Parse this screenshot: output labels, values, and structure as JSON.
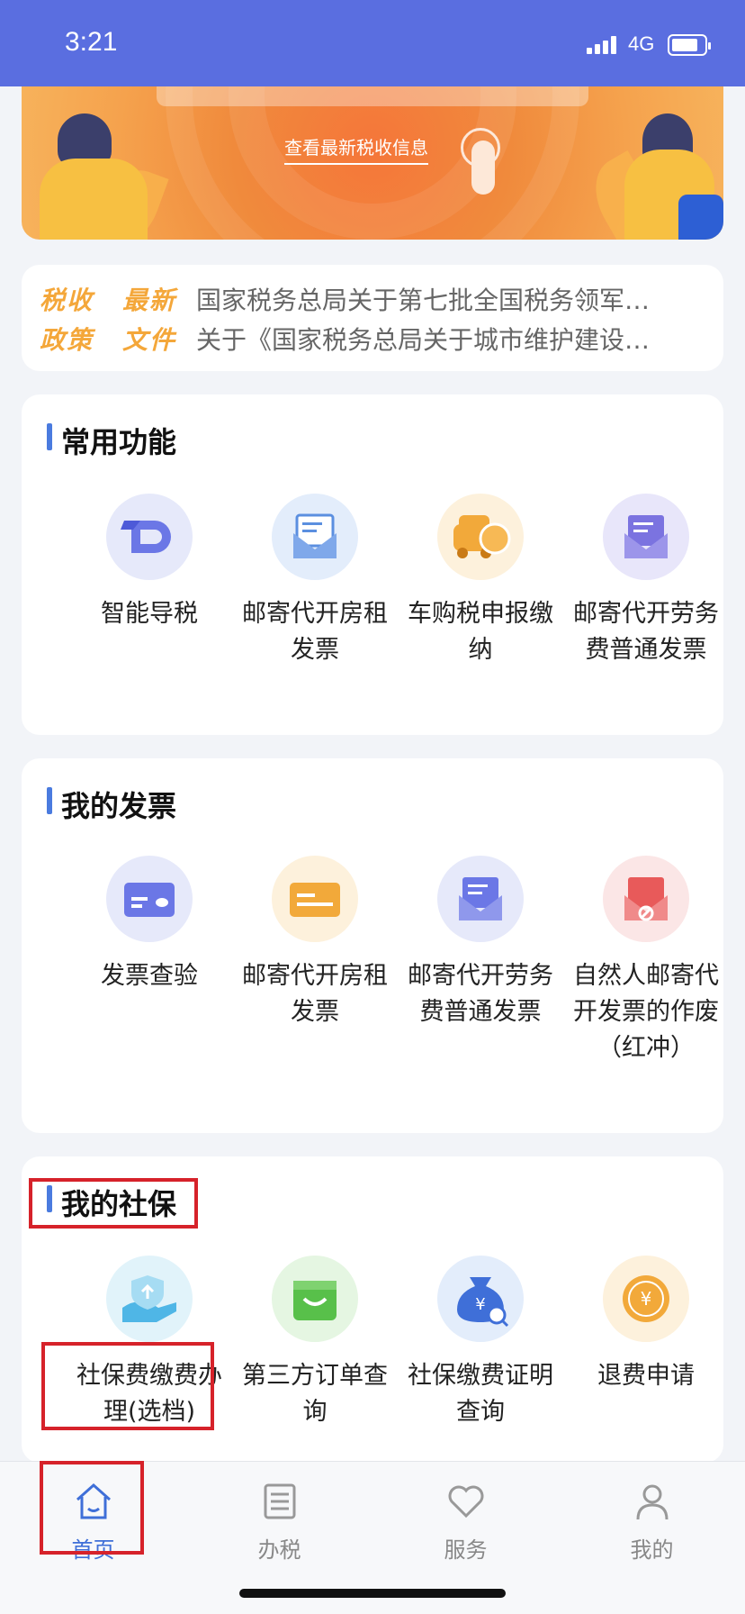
{
  "status_bar": {
    "time": "3:21",
    "network": "4G"
  },
  "banner": {
    "link_text": "查看最新税收信息"
  },
  "news": {
    "tag_left": [
      "税收",
      "政策"
    ],
    "tag_right": [
      "最新",
      "文件"
    ],
    "lines": [
      "国家税务总局关于第七批全国税务领军…",
      "关于《国家税务总局关于城市维护建设…"
    ]
  },
  "sections": [
    {
      "title": "常用功能",
      "items": [
        {
          "label": "智能导税",
          "icon": "smart-guide-icon"
        },
        {
          "label": "邮寄代开房租发票",
          "icon": "mail-house-invoice-icon"
        },
        {
          "label": "车购税申报缴纳",
          "icon": "car-tax-icon"
        },
        {
          "label": "邮寄代开劳务费普通发票",
          "icon": "mail-labor-invoice-icon"
        }
      ]
    },
    {
      "title": "我的发票",
      "items": [
        {
          "label": "发票查验",
          "icon": "invoice-check-icon"
        },
        {
          "label": "邮寄代开房租发票",
          "icon": "house-invoice-icon"
        },
        {
          "label": "邮寄代开劳务费普通发票",
          "icon": "labor-invoice-icon"
        },
        {
          "label": "自然人邮寄代开发票的作废（红冲）",
          "icon": "invoice-void-icon"
        }
      ]
    },
    {
      "title": "我的社保",
      "items": [
        {
          "label": "社保费缴费办理(选档)",
          "icon": "social-insurance-pay-icon"
        },
        {
          "label": "第三方订单查询",
          "icon": "shopping-bag-icon"
        },
        {
          "label": "社保缴费证明查询",
          "icon": "money-bag-search-icon"
        },
        {
          "label": "退费申请",
          "icon": "refund-icon"
        }
      ]
    }
  ],
  "tabbar": [
    {
      "label": "首页",
      "icon": "home-icon",
      "active": true
    },
    {
      "label": "办税",
      "icon": "list-icon",
      "active": false
    },
    {
      "label": "服务",
      "icon": "heart-icon",
      "active": false
    },
    {
      "label": "我的",
      "icon": "user-icon",
      "active": false
    }
  ],
  "colors": {
    "status_bar": "#5a6ee0",
    "accent": "#3f6fd8",
    "highlight": "#d6222a",
    "news_tag": "#f4a73a"
  }
}
